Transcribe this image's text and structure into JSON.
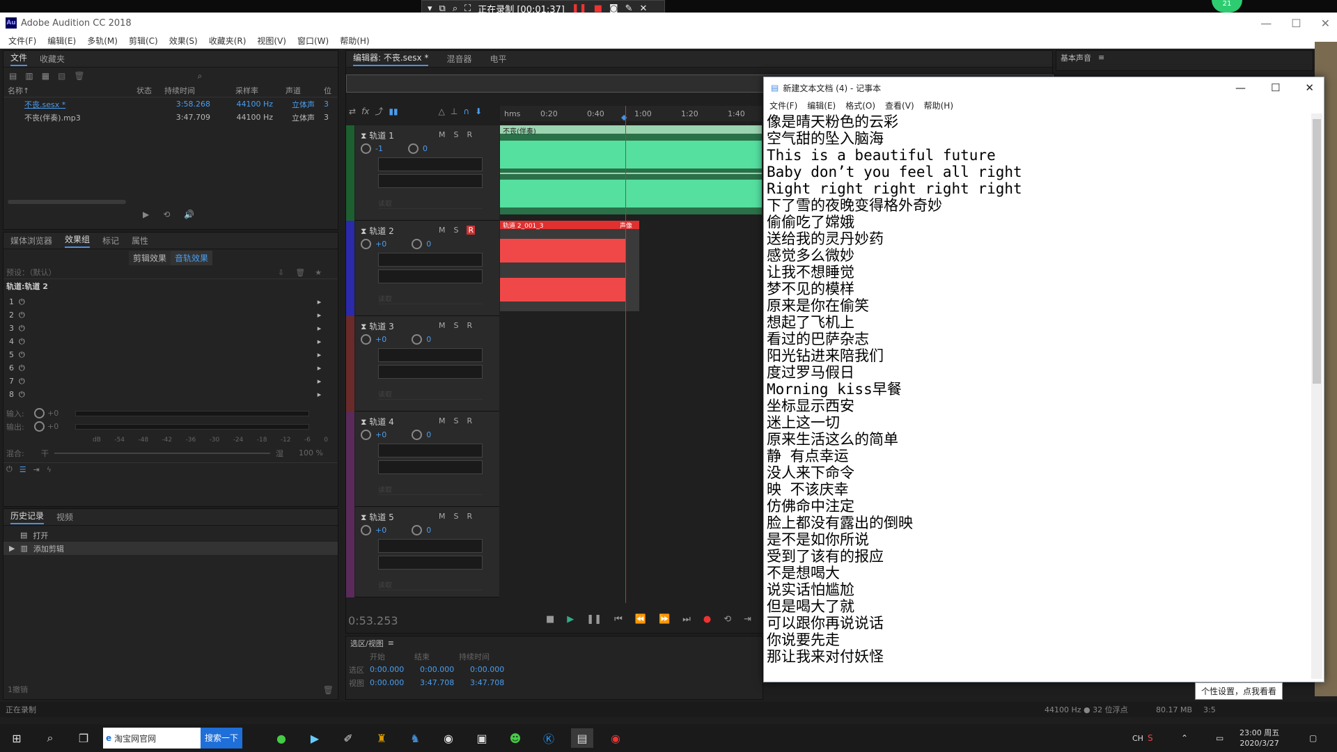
{
  "recorder": {
    "status": "正在录制 [00:01:37]"
  },
  "app": {
    "title": "Adobe Audition CC 2018",
    "logo": "Au"
  },
  "menu": [
    "文件(F)",
    "编辑(E)",
    "多轨(M)",
    "剪辑(C)",
    "效果(S)",
    "收藏夹(R)",
    "视图(V)",
    "窗口(W)",
    "帮助(H)"
  ],
  "files_panel": {
    "tabs": [
      "文件",
      "收藏夹"
    ],
    "headers": [
      "名称↑",
      "状态",
      "持续时间",
      "采样率",
      "声道",
      "位"
    ],
    "rows": [
      {
        "name": "不丧.sesx *",
        "duration": "3:58.268",
        "rate": "44100 Hz",
        "channels": "立体声",
        "bits": "3"
      },
      {
        "name": "不丧(伴奏).mp3",
        "duration": "3:47.709",
        "rate": "44100 Hz",
        "channels": "立体声",
        "bits": "3"
      }
    ]
  },
  "effects_panel": {
    "tabs": [
      "媒体浏览器",
      "效果组",
      "标记",
      "属性"
    ],
    "subtabs": [
      "剪辑效果",
      "音轨效果"
    ],
    "preset": "预设：（默认）",
    "track": "轨道:轨道 2",
    "slots": [
      "1",
      "2",
      "3",
      "4",
      "5",
      "6",
      "7",
      "8"
    ],
    "input_label": "输入:",
    "output_label": "输出:",
    "gain": "+0",
    "db_scale": [
      "dB",
      "-54",
      "-48",
      "-42",
      "-36",
      "-30",
      "-24",
      "-18",
      "-12",
      "-6",
      "0"
    ],
    "mix_label": "混合:",
    "mix_dry": "干",
    "mix_wet": "湿",
    "mix_value": "100 %"
  },
  "history_panel": {
    "tabs": [
      "历史记录",
      "视频"
    ],
    "items": [
      "打开",
      "添加剪辑"
    ],
    "footer": "1撤销"
  },
  "editor": {
    "tabs": [
      "编辑器: 不丧.sesx *",
      "混音器",
      "电平"
    ],
    "ruler": [
      "hms",
      "0:20",
      "0:40",
      "1:00",
      "1:20",
      "1:40"
    ],
    "clip1_label": "不丧(伴奏)",
    "clip2_label": "轨道 2_001_3",
    "clip2_tag": "声像",
    "time": "0:53.253",
    "tracks": [
      {
        "name": "轨道 1",
        "vol": "-1",
        "pan": "0",
        "color": "#4caf50"
      },
      {
        "name": "轨道 2",
        "vol": "+0",
        "pan": "0",
        "color": "#3a3aff"
      },
      {
        "name": "轨道 3",
        "vol": "+0",
        "pan": "0",
        "color": "#c84a4a"
      },
      {
        "name": "轨道 4",
        "vol": "+0",
        "pan": "0",
        "color": "#c04ab0"
      },
      {
        "name": "轨道 5",
        "vol": "+0",
        "pan": "0",
        "color": "#c04ab0"
      }
    ],
    "msr": [
      "M",
      "S",
      "R"
    ],
    "read": "读取"
  },
  "selection": {
    "title": "选区/视图",
    "headers": [
      "开始",
      "结束",
      "持续时间"
    ],
    "sel_label": "选区",
    "view_label": "视图",
    "sel": [
      "0:00.000",
      "0:00.000",
      "0:00.000"
    ],
    "view": [
      "0:00.000",
      "3:47.708",
      "3:47.708"
    ]
  },
  "essential_sound": {
    "title": "基本声音"
  },
  "statusbar": {
    "left": "正在录制",
    "format": "44100 Hz ● 32 位浮点",
    "size": "80.17 MB",
    "extra": "3:5"
  },
  "notepad": {
    "title": "新建文本文档 (4) - 记事本",
    "menu": [
      "文件(F)",
      "编辑(E)",
      "格式(O)",
      "查看(V)",
      "帮助(H)"
    ],
    "lines": [
      "像是晴天粉色的云彩",
      "空气甜的坠入脑海",
      "This is a beautiful future",
      "Baby don’t you feel all right",
      "Right right right right right",
      "下了雪的夜晚变得格外奇妙",
      "偷偷吃了嫦娥",
      "送给我的灵丹妙药",
      "感觉多么微妙",
      "让我不想睡觉",
      "梦不见的模样",
      "原来是你在偷笑",
      "想起了飞机上",
      "看过的巴萨杂志",
      "阳光钻进来陪我们",
      "度过罗马假日",
      "Morning kiss早餐",
      "坐标显示西安",
      "迷上这一切",
      "原来生活这么的简单",
      "静 有点幸运",
      "没人来下命令",
      "映 不该庆幸",
      "仿佛命中注定",
      "脸上都没有露出的倒映",
      "是不是如你所说",
      "受到了该有的报应",
      "不是想喝大",
      "说实话怕尴尬",
      "但是喝大了就",
      "可以跟你再说说话",
      "你说要先走",
      "那让我来对付妖怪"
    ]
  },
  "tooltip": "个性设置，点我看看",
  "taskbar": {
    "browser": "淘宝网官网",
    "search_btn": "搜索一下",
    "ime": "CH",
    "time": "23:00 周五",
    "date": "2020/3/27"
  },
  "badge": "21"
}
